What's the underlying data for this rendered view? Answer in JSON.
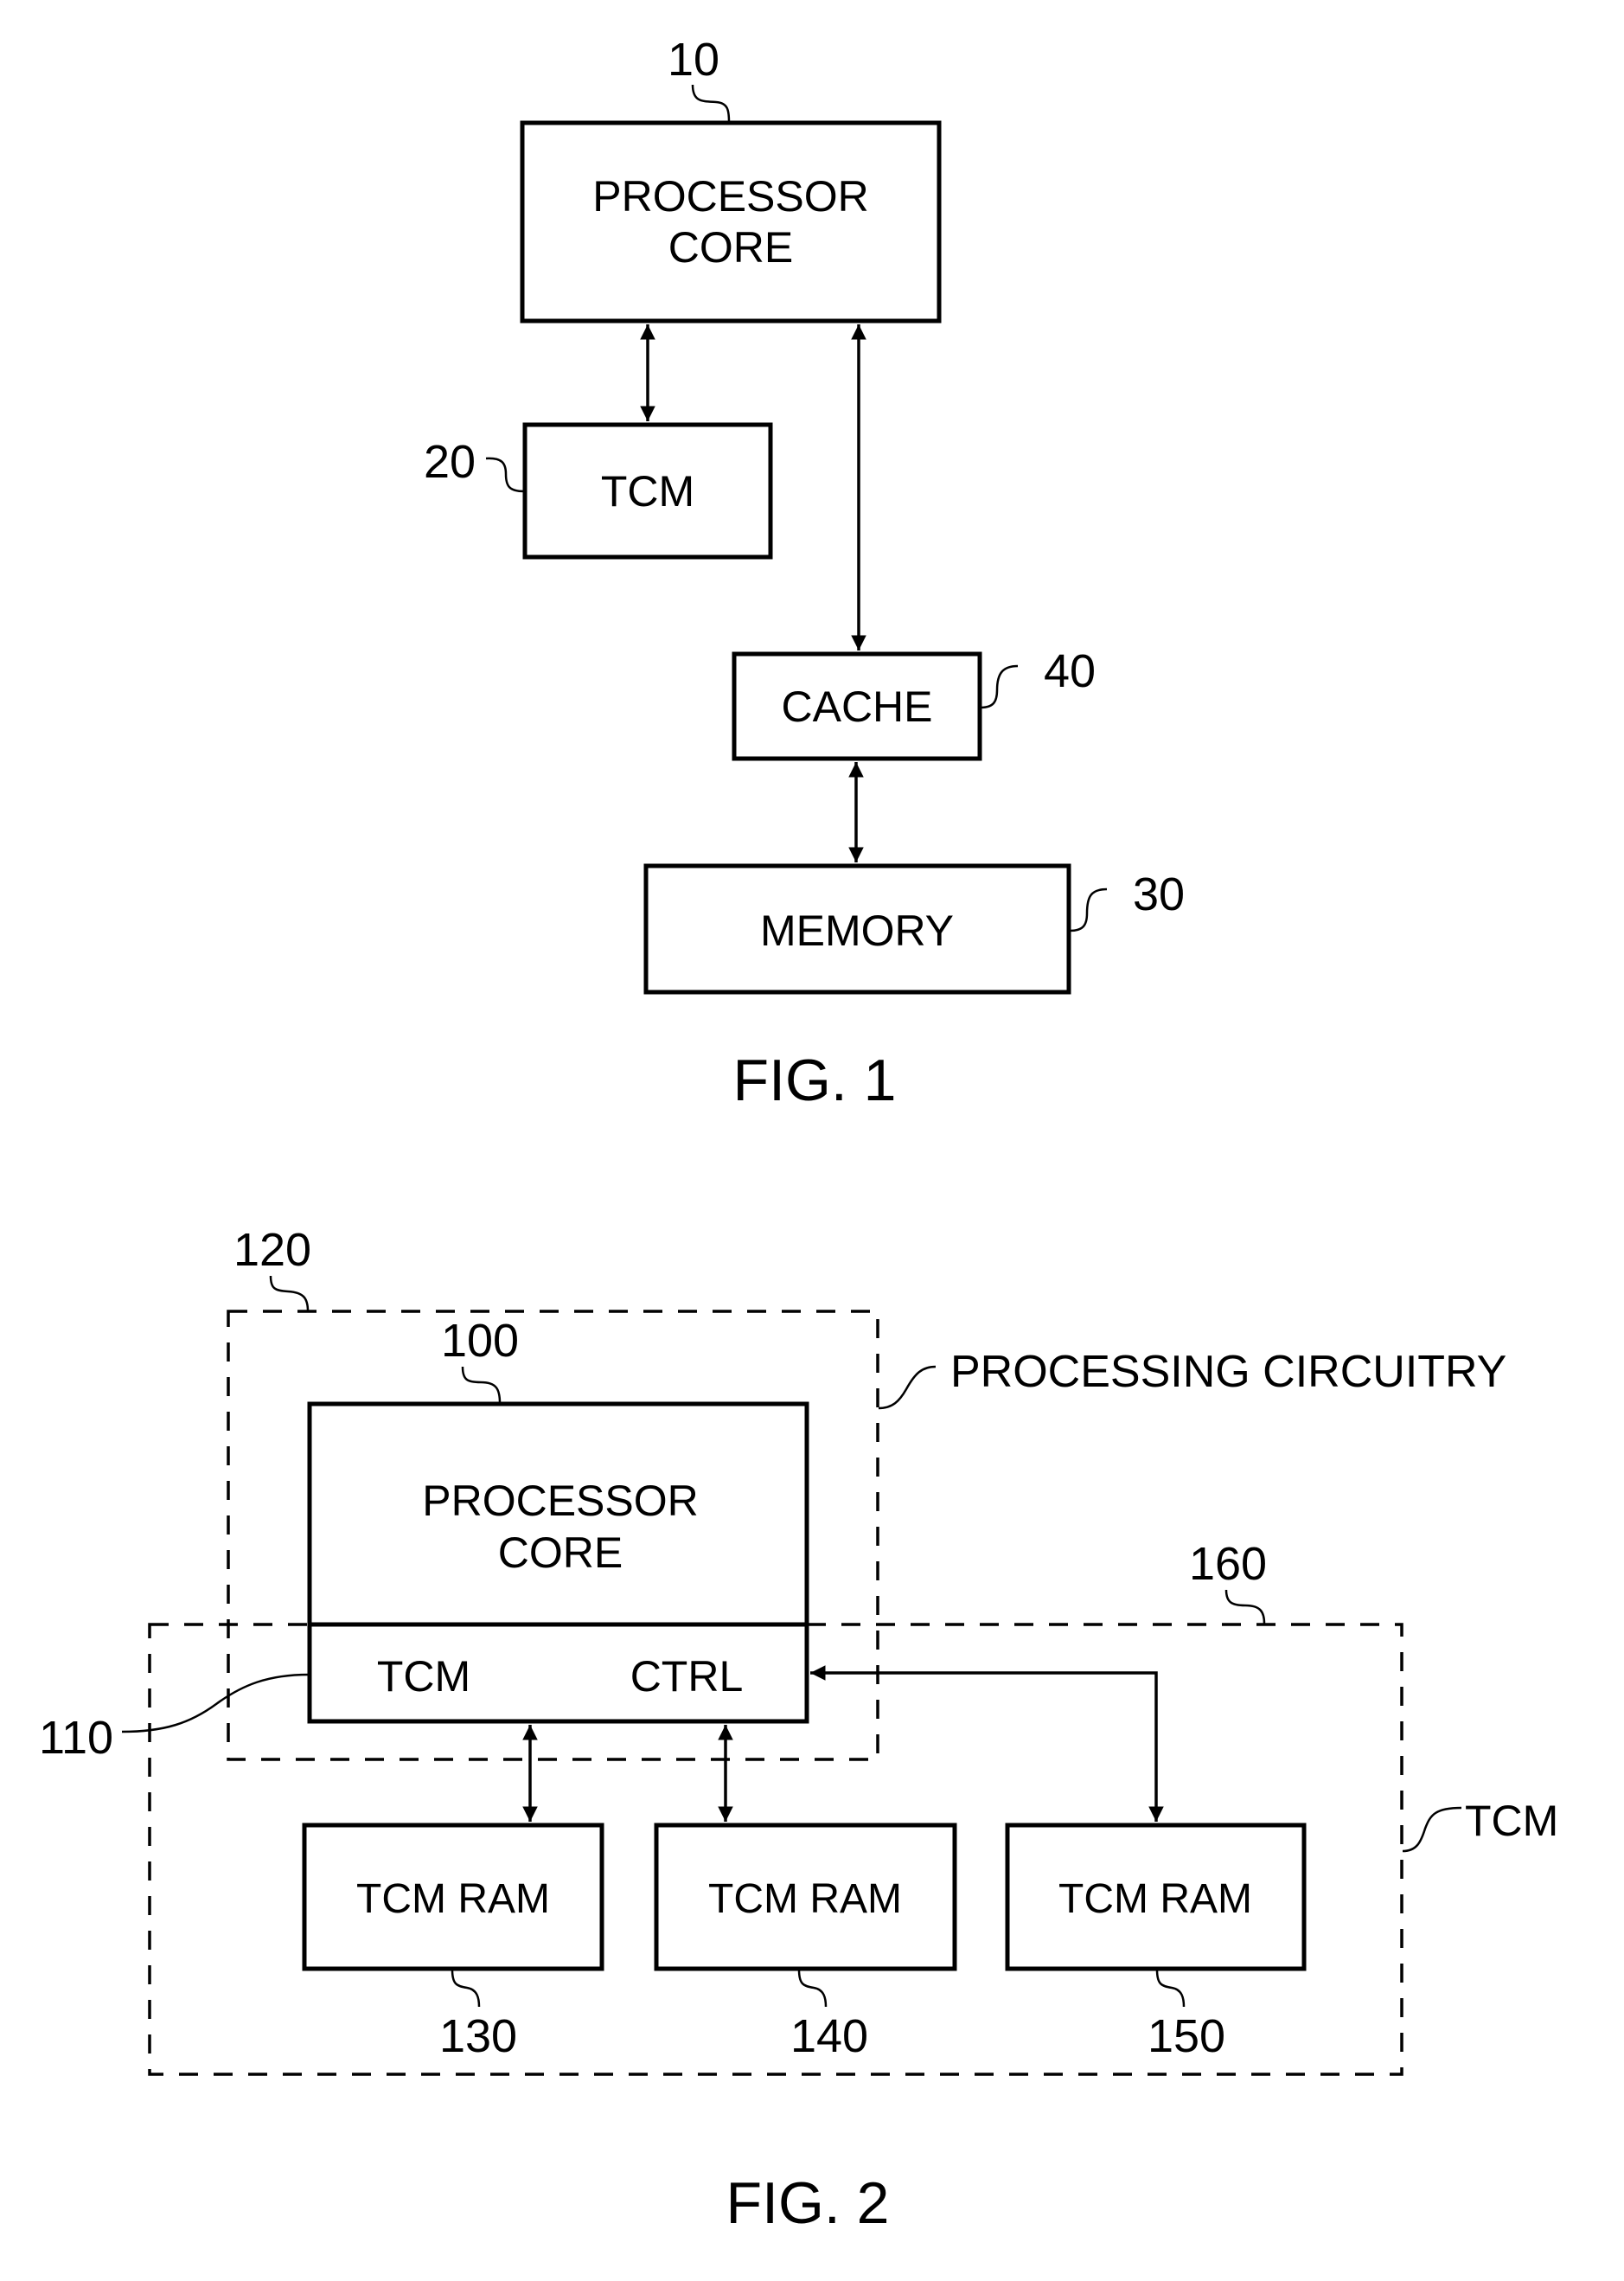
{
  "figures": [
    {
      "caption": "FIG. 1",
      "blocks": {
        "processor_core": {
          "ref": "10",
          "lines": [
            "PROCESSOR",
            "CORE"
          ]
        },
        "tcm": {
          "ref": "20",
          "label": "TCM"
        },
        "cache": {
          "ref": "40",
          "label": "CACHE"
        },
        "memory": {
          "ref": "30",
          "label": "MEMORY"
        }
      },
      "connections": [
        {
          "from": "processor_core",
          "to": "tcm",
          "type": "bidirectional"
        },
        {
          "from": "processor_core",
          "to": "cache",
          "type": "bidirectional"
        },
        {
          "from": "cache",
          "to": "memory",
          "type": "bidirectional"
        }
      ]
    },
    {
      "caption": "FIG. 2",
      "regions": {
        "processing_circuitry": {
          "ref": "120",
          "label": "PROCESSING CIRCUITRY"
        },
        "tcm_region": {
          "ref": "160",
          "label": "TCM"
        }
      },
      "blocks": {
        "processor_core": {
          "ref": "100",
          "lines": [
            "PROCESSOR",
            "CORE"
          ]
        },
        "tcm_ctrl": {
          "ref": "110",
          "left_label": "TCM",
          "right_label": "CTRL"
        },
        "tcm_ram_1": {
          "ref": "130",
          "label": "TCM RAM"
        },
        "tcm_ram_2": {
          "ref": "140",
          "label": "TCM RAM"
        },
        "tcm_ram_3": {
          "ref": "150",
          "label": "TCM RAM"
        }
      },
      "connections": [
        {
          "from": "tcm_ctrl",
          "to": "tcm_ram_1",
          "type": "bidirectional"
        },
        {
          "from": "tcm_ctrl",
          "to": "tcm_ram_2",
          "type": "bidirectional"
        },
        {
          "from": "tcm_ctrl",
          "to": "tcm_ram_3",
          "type": "bidirectional"
        }
      ]
    }
  ]
}
